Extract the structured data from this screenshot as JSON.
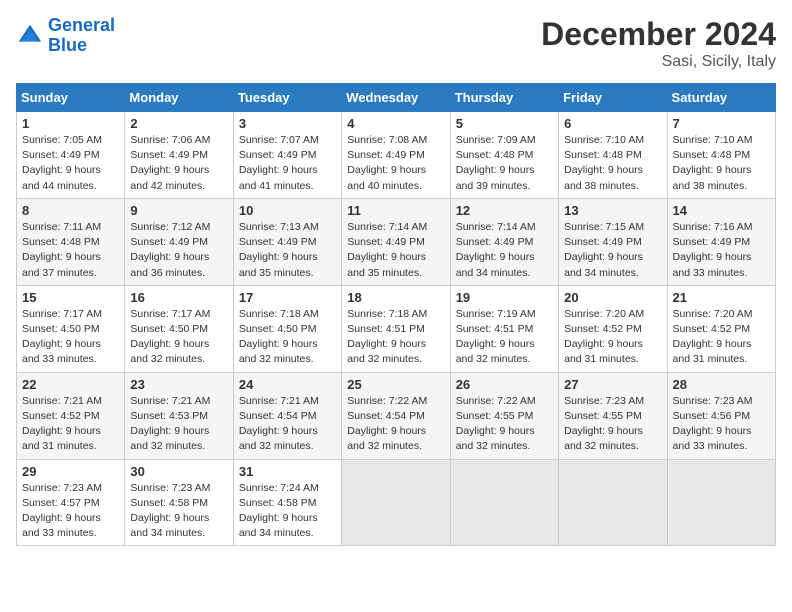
{
  "header": {
    "logo_line1": "General",
    "logo_line2": "Blue",
    "month": "December 2024",
    "location": "Sasi, Sicily, Italy"
  },
  "days_of_week": [
    "Sunday",
    "Monday",
    "Tuesday",
    "Wednesday",
    "Thursday",
    "Friday",
    "Saturday"
  ],
  "weeks": [
    [
      {
        "day": "1",
        "sunrise": "7:05 AM",
        "sunset": "4:49 PM",
        "daylight": "9 hours and 44 minutes."
      },
      {
        "day": "2",
        "sunrise": "7:06 AM",
        "sunset": "4:49 PM",
        "daylight": "9 hours and 42 minutes."
      },
      {
        "day": "3",
        "sunrise": "7:07 AM",
        "sunset": "4:49 PM",
        "daylight": "9 hours and 41 minutes."
      },
      {
        "day": "4",
        "sunrise": "7:08 AM",
        "sunset": "4:49 PM",
        "daylight": "9 hours and 40 minutes."
      },
      {
        "day": "5",
        "sunrise": "7:09 AM",
        "sunset": "4:48 PM",
        "daylight": "9 hours and 39 minutes."
      },
      {
        "day": "6",
        "sunrise": "7:10 AM",
        "sunset": "4:48 PM",
        "daylight": "9 hours and 38 minutes."
      },
      {
        "day": "7",
        "sunrise": "7:10 AM",
        "sunset": "4:48 PM",
        "daylight": "9 hours and 38 minutes."
      }
    ],
    [
      {
        "day": "8",
        "sunrise": "7:11 AM",
        "sunset": "4:48 PM",
        "daylight": "9 hours and 37 minutes."
      },
      {
        "day": "9",
        "sunrise": "7:12 AM",
        "sunset": "4:49 PM",
        "daylight": "9 hours and 36 minutes."
      },
      {
        "day": "10",
        "sunrise": "7:13 AM",
        "sunset": "4:49 PM",
        "daylight": "9 hours and 35 minutes."
      },
      {
        "day": "11",
        "sunrise": "7:14 AM",
        "sunset": "4:49 PM",
        "daylight": "9 hours and 35 minutes."
      },
      {
        "day": "12",
        "sunrise": "7:14 AM",
        "sunset": "4:49 PM",
        "daylight": "9 hours and 34 minutes."
      },
      {
        "day": "13",
        "sunrise": "7:15 AM",
        "sunset": "4:49 PM",
        "daylight": "9 hours and 34 minutes."
      },
      {
        "day": "14",
        "sunrise": "7:16 AM",
        "sunset": "4:49 PM",
        "daylight": "9 hours and 33 minutes."
      }
    ],
    [
      {
        "day": "15",
        "sunrise": "7:17 AM",
        "sunset": "4:50 PM",
        "daylight": "9 hours and 33 minutes."
      },
      {
        "day": "16",
        "sunrise": "7:17 AM",
        "sunset": "4:50 PM",
        "daylight": "9 hours and 32 minutes."
      },
      {
        "day": "17",
        "sunrise": "7:18 AM",
        "sunset": "4:50 PM",
        "daylight": "9 hours and 32 minutes."
      },
      {
        "day": "18",
        "sunrise": "7:18 AM",
        "sunset": "4:51 PM",
        "daylight": "9 hours and 32 minutes."
      },
      {
        "day": "19",
        "sunrise": "7:19 AM",
        "sunset": "4:51 PM",
        "daylight": "9 hours and 32 minutes."
      },
      {
        "day": "20",
        "sunrise": "7:20 AM",
        "sunset": "4:52 PM",
        "daylight": "9 hours and 31 minutes."
      },
      {
        "day": "21",
        "sunrise": "7:20 AM",
        "sunset": "4:52 PM",
        "daylight": "9 hours and 31 minutes."
      }
    ],
    [
      {
        "day": "22",
        "sunrise": "7:21 AM",
        "sunset": "4:52 PM",
        "daylight": "9 hours and 31 minutes."
      },
      {
        "day": "23",
        "sunrise": "7:21 AM",
        "sunset": "4:53 PM",
        "daylight": "9 hours and 32 minutes."
      },
      {
        "day": "24",
        "sunrise": "7:21 AM",
        "sunset": "4:54 PM",
        "daylight": "9 hours and 32 minutes."
      },
      {
        "day": "25",
        "sunrise": "7:22 AM",
        "sunset": "4:54 PM",
        "daylight": "9 hours and 32 minutes."
      },
      {
        "day": "26",
        "sunrise": "7:22 AM",
        "sunset": "4:55 PM",
        "daylight": "9 hours and 32 minutes."
      },
      {
        "day": "27",
        "sunrise": "7:23 AM",
        "sunset": "4:55 PM",
        "daylight": "9 hours and 32 minutes."
      },
      {
        "day": "28",
        "sunrise": "7:23 AM",
        "sunset": "4:56 PM",
        "daylight": "9 hours and 33 minutes."
      }
    ],
    [
      {
        "day": "29",
        "sunrise": "7:23 AM",
        "sunset": "4:57 PM",
        "daylight": "9 hours and 33 minutes."
      },
      {
        "day": "30",
        "sunrise": "7:23 AM",
        "sunset": "4:58 PM",
        "daylight": "9 hours and 34 minutes."
      },
      {
        "day": "31",
        "sunrise": "7:24 AM",
        "sunset": "4:58 PM",
        "daylight": "9 hours and 34 minutes."
      },
      null,
      null,
      null,
      null
    ]
  ]
}
